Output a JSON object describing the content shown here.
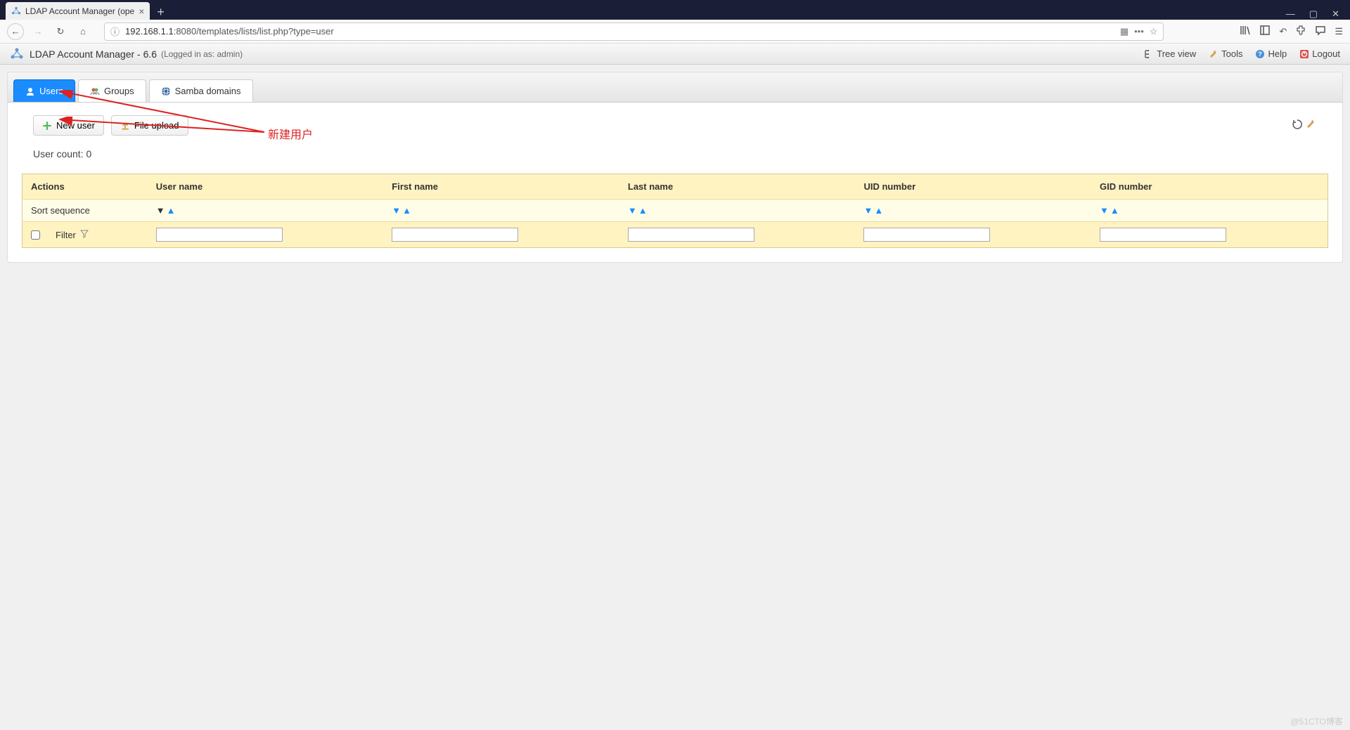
{
  "browser": {
    "tab_title": "LDAP Account Manager (ope",
    "url_host": "192.168.1.1",
    "url_rest": ":8080/templates/lists/list.php?type=user"
  },
  "header": {
    "app_title": "LDAP Account Manager - 6.6",
    "login_status": "(Logged in as: admin)",
    "links": {
      "treeview": "Tree view",
      "tools": "Tools",
      "help": "Help",
      "logout": "Logout"
    }
  },
  "tabs": {
    "users": "Users",
    "groups": "Groups",
    "samba": "Samba domains"
  },
  "actions": {
    "new_user": "New user",
    "file_upload": "File upload"
  },
  "annotation": "新建用户",
  "user_count_label": "User count: 0",
  "table": {
    "headers": {
      "actions": "Actions",
      "username": "User name",
      "firstname": "First name",
      "lastname": "Last name",
      "uid": "UID number",
      "gid": "GID number"
    },
    "sort_label": "Sort sequence",
    "filter_label": "Filter"
  },
  "watermark": "@51CTO博客"
}
